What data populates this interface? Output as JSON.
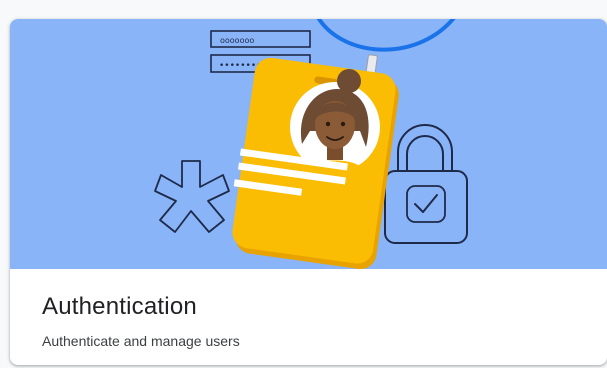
{
  "card": {
    "title": "Authentication",
    "subtitle": "Authenticate and manage users",
    "illustration": {
      "username_field_text": "ooooooo",
      "password_field_text": "••••••••••",
      "icons": [
        "password-fields-icon",
        "id-badge-icon",
        "avatar-icon",
        "asterisk-icon",
        "padlock-check-icon"
      ]
    }
  },
  "colors": {
    "hero_background": "#8ab4f8",
    "badge": "#fbbc04",
    "lanyard": "#1a73e8",
    "line_art": "#1e2a4a",
    "title_text": "#202124",
    "subtitle_text": "#3c4043"
  }
}
